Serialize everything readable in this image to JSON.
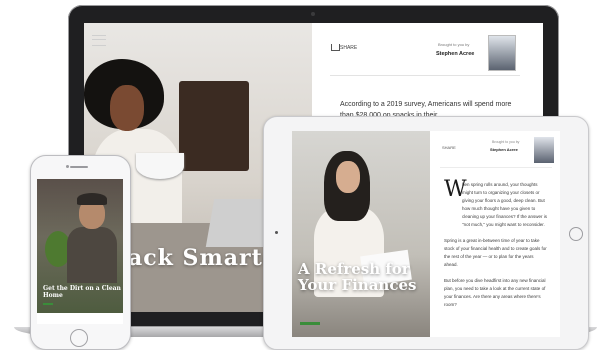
{
  "laptop": {
    "hero_title": "ack Smarter",
    "hero_subtitle": "",
    "share_label": "SHARE",
    "brought_by": "Brought to you by",
    "author": "Stephen Acree",
    "article_text": "According to a 2019 survey, Americans will spend more than $28,000 on snacks in their"
  },
  "tablet": {
    "hero_title": "A Refresh for Your Finances",
    "meta": "",
    "share_label": "SHARE",
    "brought_by": "Brought to you by",
    "author": "Stephen Acree",
    "dropcap": "W",
    "para1": "hen spring rolls around, your thoughts might turn to organizing your closets or giving your floors a good, deep clean. But how much thought have you given to cleaning up your finances? If the answer is \"not much,\" you might want to reconsider.",
    "para2": "Spring is a great in-between time of year to take stock of your financial health and to create goals for the rest of the year — or to plan for the years ahead.",
    "para3": "But before you dive headfirst into any new financial plan, you need to take a look at the current state of your finances. Are there any areas where there's room?"
  },
  "phone": {
    "hero_subtitle": "",
    "hero_title": "Get the Dirt on a Clean Home",
    "nav_items": [
      "",
      "",
      ""
    ]
  },
  "colors": {
    "accent_green": "#3a8d3a",
    "highlight": "#dff1d8"
  }
}
